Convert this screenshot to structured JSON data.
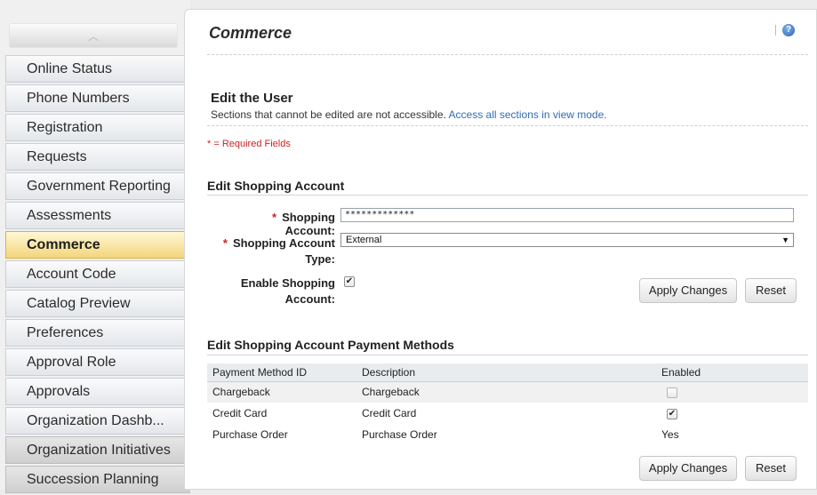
{
  "sidebar": {
    "items": [
      {
        "label": "Online Status",
        "state": "normal"
      },
      {
        "label": "Phone Numbers",
        "state": "normal"
      },
      {
        "label": "Registration",
        "state": "normal"
      },
      {
        "label": "Requests",
        "state": "normal"
      },
      {
        "label": "Government Reporting",
        "state": "normal"
      },
      {
        "label": "Assessments",
        "state": "normal"
      },
      {
        "label": "Commerce",
        "state": "active"
      },
      {
        "label": "Account Code",
        "state": "normal"
      },
      {
        "label": "Catalog Preview",
        "state": "normal"
      },
      {
        "label": "Preferences",
        "state": "normal"
      },
      {
        "label": "Approval Role",
        "state": "normal"
      },
      {
        "label": "Approvals",
        "state": "normal"
      },
      {
        "label": "Organization Dashb...",
        "state": "normal"
      },
      {
        "label": "Organization Initiatives",
        "state": "gray"
      },
      {
        "label": "Succession Planning",
        "state": "gray"
      }
    ]
  },
  "page": {
    "title": "Commerce",
    "help_glyph": "?"
  },
  "edit_user": {
    "heading": "Edit the User",
    "note": "Sections that cannot be edited are not accessible.",
    "note_link": "Access all sections in view mode.",
    "required_note": "* = Required Fields"
  },
  "shopping_account": {
    "heading": "Edit Shopping Account",
    "account_label": "Shopping Account:",
    "account_value": "*************",
    "type_label_1": "Shopping Account",
    "type_label_2": "Type:",
    "type_value": "External",
    "enable_label_1": "Enable Shopping",
    "enable_label_2": "Account:",
    "enable_checked": true,
    "apply_label": "Apply Changes",
    "reset_label": "Reset"
  },
  "payment_methods": {
    "heading": "Edit Shopping Account Payment Methods",
    "columns": [
      "Payment Method ID",
      "Description",
      "Enabled"
    ],
    "rows": [
      {
        "id": "Chargeback",
        "description": "Chargeback",
        "enabled": "unchecked"
      },
      {
        "id": "Credit Card",
        "description": "Credit Card",
        "enabled": "checked"
      },
      {
        "id": "Purchase Order",
        "description": "Purchase Order",
        "enabled": "Yes"
      }
    ],
    "apply_label": "Apply Changes",
    "reset_label": "Reset"
  },
  "colors": {
    "active_tab": "#f3d57c",
    "link": "#2f6db5",
    "required": "#d21f1f"
  }
}
